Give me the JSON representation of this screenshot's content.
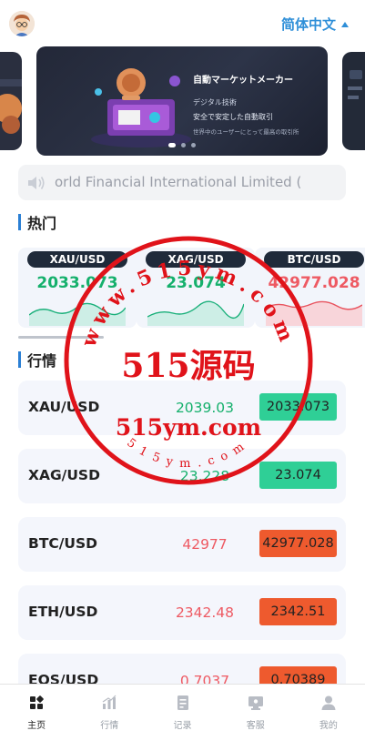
{
  "header": {
    "language_label": "简体中文"
  },
  "banner": {
    "title": "自動マーケットメーカー",
    "subtitle": "デジタル技術",
    "line1": "安全で安定した自動取引",
    "line2": "世界中のユーザーにとって最高の取引所"
  },
  "notice": {
    "text": "orld Financial International Limited ("
  },
  "sections": {
    "hot_title": "热门",
    "market_title": "行情"
  },
  "hot": [
    {
      "symbol": "XAU/USD",
      "price": "2033.073",
      "color": "#15b06c"
    },
    {
      "symbol": "XAG/USD",
      "price": "23.074",
      "color": "#15b06c"
    },
    {
      "symbol": "BTC/USD",
      "price": "42977.028",
      "color": "#ee5a63"
    }
  ],
  "market": [
    {
      "name": "XAU/USD",
      "last": "2039.03",
      "change": "2033.073",
      "last_color": "#15b06c",
      "box_color": "#2fcf96"
    },
    {
      "name": "XAG/USD",
      "last": "23.228",
      "change": "23.074",
      "last_color": "#15b06c",
      "box_color": "#2fcf96"
    },
    {
      "name": "BTC/USD",
      "last": "42977",
      "change": "42977.028",
      "last_color": "#ee5a63",
      "box_color": "#ee5a2e"
    },
    {
      "name": "ETH/USD",
      "last": "2342.48",
      "change": "2342.51",
      "last_color": "#ee5a63",
      "box_color": "#ee5a2e"
    },
    {
      "name": "EOS/USD",
      "last": "0.7037",
      "change": "0.70389",
      "last_color": "#ee5a63",
      "box_color": "#ee5a2e"
    }
  ],
  "tabbar": [
    {
      "label": "主页",
      "icon": "home-icon"
    },
    {
      "label": "行情",
      "icon": "chart-icon"
    },
    {
      "label": "记录",
      "icon": "record-icon"
    },
    {
      "label": "客服",
      "icon": "support-icon"
    },
    {
      "label": "我的",
      "icon": "profile-icon"
    }
  ],
  "watermark": {
    "big": "515源码",
    "url": "515ym.com",
    "arc_top": "www.515ym.com",
    "arc_bottom": "515ym.com"
  }
}
